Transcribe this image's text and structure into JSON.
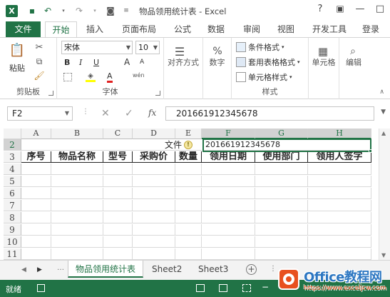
{
  "window": {
    "title": "物品领用统计表 - Excel"
  },
  "qat": [
    "save-icon",
    "undo-icon",
    "redo-icon",
    "camera-icon"
  ],
  "window_controls": {
    "help": "?",
    "restore": "▣",
    "minimize": "—",
    "maximize": "□"
  },
  "tabs": [
    "文件",
    "开始",
    "插入",
    "页面布局",
    "公式",
    "数据",
    "审阅",
    "视图",
    "开发工具",
    "登录"
  ],
  "ribbon": {
    "clipboard": {
      "paste": "粘贴",
      "label": "剪贴板"
    },
    "font": {
      "name": "宋体",
      "size": "10",
      "bold": "B",
      "italic": "I",
      "underline": "U",
      "grow": "A",
      "shrink": "A",
      "color": "A",
      "phonetic": "wén",
      "label": "字体"
    },
    "alignment": {
      "label": "对齐方式"
    },
    "number": {
      "symbol": "%",
      "label": "数字"
    },
    "styles": {
      "conditional": "条件格式",
      "table": "套用表格格式",
      "cell": "单元格样式",
      "label": "样式"
    },
    "cells": {
      "label": "单元格"
    },
    "editing": {
      "label": "编辑"
    }
  },
  "formula_bar": {
    "name_box": "F2",
    "fx": "fx",
    "cancel": "✕",
    "enter": "✓",
    "value": "201661912345678"
  },
  "grid": {
    "columns": [
      "A",
      "B",
      "C",
      "D",
      "E",
      "F",
      "G",
      "H"
    ],
    "rows": [
      "2",
      "3",
      "4",
      "5",
      "6",
      "7",
      "8",
      "9",
      "10",
      "11"
    ],
    "row2_label": "文件",
    "row2_value": "201661912345678",
    "headers": [
      "序号",
      "物品名称",
      "型号",
      "采购价",
      "数量",
      "领用日期",
      "使用部门",
      "领用人签字"
    ]
  },
  "sheets": {
    "tabs": [
      "物品领用统计表",
      "Sheet2",
      "Sheet3"
    ],
    "add": "+"
  },
  "status": {
    "ready": "就绪"
  },
  "watermark": {
    "brand": "Office教程网",
    "url": "https://www.exceljcw.com"
  },
  "colors": {
    "accent": "#217346",
    "watermark_orange": "#e8501f",
    "watermark_blue": "#2d77c2"
  }
}
